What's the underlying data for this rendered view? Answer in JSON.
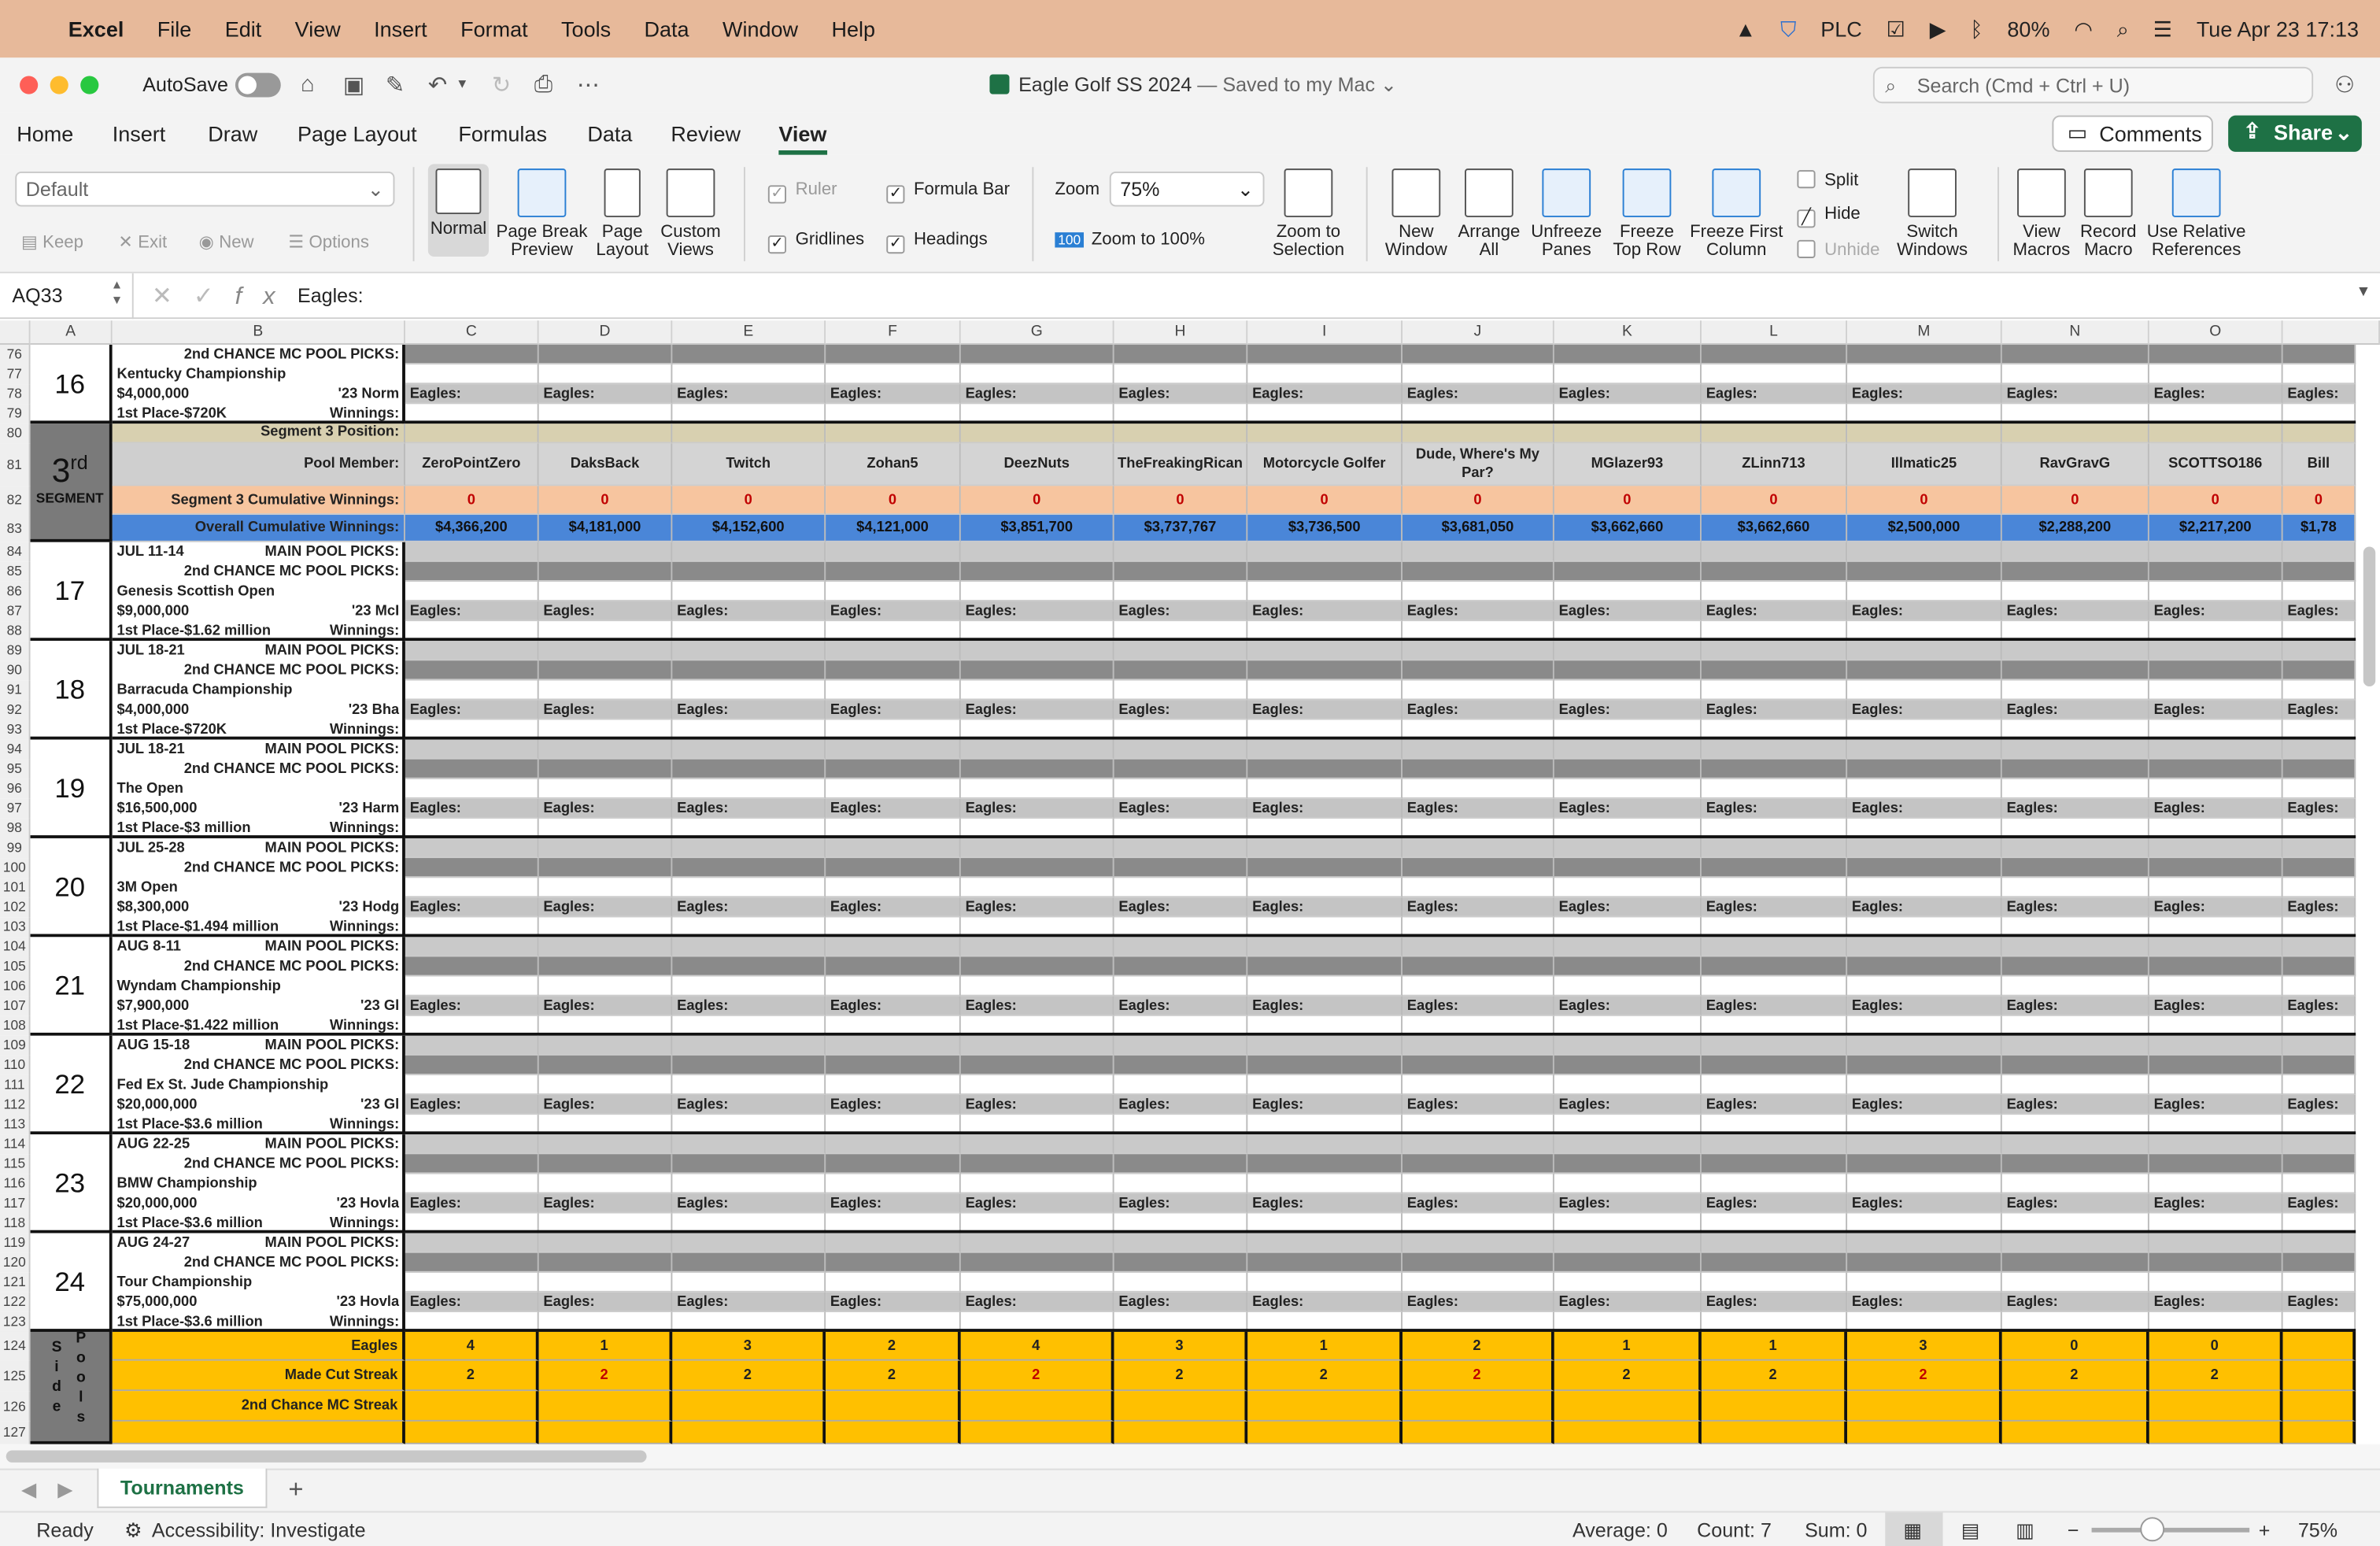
{
  "menubar": {
    "app": "Excel",
    "items": [
      "File",
      "Edit",
      "View",
      "Insert",
      "Format",
      "Tools",
      "Data",
      "Window",
      "Help"
    ],
    "plc": "PLC",
    "battery": "80%",
    "datetime": "Tue Apr 23  17:13"
  },
  "titlebar": {
    "autosave": "AutoSave",
    "doc_title": "Eagle Golf SS 2024",
    "saved": "— Saved to my Mac",
    "search_placeholder": "Search (Cmd + Ctrl + U)"
  },
  "tabs": [
    "Home",
    "Insert",
    "Draw",
    "Page Layout",
    "Formulas",
    "Data",
    "Review",
    "View"
  ],
  "active_tab": "View",
  "buttons": {
    "comments": "Comments",
    "share": "Share"
  },
  "ribbon": {
    "sheet_view": "Default",
    "keep": "Keep",
    "exit": "Exit",
    "new": "New",
    "options": "Options",
    "normal": "Normal",
    "page_break": "Page Break",
    "page_break2": "Preview",
    "page_layout": "Page",
    "page_layout2": "Layout",
    "custom": "Custom",
    "custom2": "Views",
    "ruler": "Ruler",
    "formula_bar": "Formula Bar",
    "gridlines": "Gridlines",
    "headings": "Headings",
    "zoom": "Zoom",
    "zoom_value": "75%",
    "zoom100_icon": "100",
    "zoom100": "Zoom to 100%",
    "zoom_sel": "Zoom to",
    "zoom_sel2": "Selection",
    "new_window": "New",
    "new_window2": "Window",
    "arrange": "Arrange",
    "arrange2": "All",
    "unfreeze": "Unfreeze",
    "unfreeze2": "Panes",
    "freeze_top": "Freeze",
    "freeze_top2": "Top Row",
    "freeze_first": "Freeze First",
    "freeze_first2": "Column",
    "split": "Split",
    "hide": "Hide",
    "unhide": "Unhide",
    "switch": "Switch",
    "switch2": "Windows",
    "view_macros": "View",
    "view_macros2": "Macros",
    "record": "Record",
    "record2": "Macro",
    "relative": "Use Relative",
    "relative2": "References"
  },
  "formula_bar": {
    "cell_ref": "AQ33",
    "fx": "fx",
    "value": "Eagles:"
  },
  "columns": [
    "A",
    "B",
    "C",
    "D",
    "E",
    "F",
    "G",
    "H",
    "I",
    "J",
    "K",
    "L",
    "M",
    "N",
    "O"
  ],
  "players": [
    "ZeroPointZero",
    "DaksBack",
    "Twitch",
    "Zohan5",
    "DeezNuts",
    "TheFreakingRican",
    "Motorcycle Golfer",
    "Dude, Where's My Par?",
    "MGlazer93",
    "ZLinn713",
    "Illmatic25",
    "RavGravG",
    "SCOTTSO186",
    "Bill"
  ],
  "segment": {
    "big": "3",
    "sup": "rd",
    "label": "SEGMENT",
    "position_label": "Segment 3 Position:",
    "pool_member": "Pool Member:",
    "seg_cum": "Segment 3 Cumulative Winnings:",
    "overall": "Overall Cumulative  Winnings:"
  },
  "seg_values": [
    "0",
    "0",
    "0",
    "0",
    "0",
    "0",
    "0",
    "0",
    "0",
    "0",
    "0",
    "0",
    "0",
    "0"
  ],
  "overall_values": [
    "$4,366,200",
    "$4,181,000",
    "$4,152,600",
    "$4,121,000",
    "$3,851,700",
    "$3,737,767",
    "$3,736,500",
    "$3,681,050",
    "$3,662,660",
    "$3,662,660",
    "$2,500,000",
    "$2,288,200",
    "$2,217,200",
    "$1,78"
  ],
  "eagles_label": "Eagles:",
  "labels": {
    "main": "MAIN POOL PICKS:",
    "chance": "2nd CHANCE MC POOL PICKS:",
    "winnings": "Winnings:"
  },
  "events": [
    {
      "num": "16",
      "rows": [
        "76",
        "77",
        "78",
        "79"
      ],
      "date": "",
      "name": "Kentucky Championship",
      "purse": "$4,000,000",
      "prev": "'23  Norm",
      "first": "1st Place-$720K"
    },
    {
      "num": "17",
      "rows": [
        "84",
        "85",
        "86",
        "87",
        "88"
      ],
      "date": "JUL 11-14",
      "name": "Genesis Scottish Open",
      "purse": "$9,000,000",
      "prev": "'23 McI",
      "first": "1st Place-$1.62 million"
    },
    {
      "num": "18",
      "rows": [
        "89",
        "90",
        "91",
        "92",
        "93"
      ],
      "date": "JUL 18-21",
      "name": "Barracuda Championship",
      "purse": "$4,000,000",
      "prev": "'23 Bha",
      "first": "1st Place-$720K"
    },
    {
      "num": "19",
      "rows": [
        "94",
        "95",
        "96",
        "97",
        "98"
      ],
      "date": "JUL 18-21",
      "name": "The Open",
      "purse": "$16,500,000",
      "prev": "'23  Harm",
      "first": "1st  Place-$3 million"
    },
    {
      "num": "20",
      "rows": [
        "99",
        "100",
        "101",
        "102",
        "103"
      ],
      "date": "JUL 25-28",
      "name": "3M Open",
      "purse": "$8,300,000",
      "prev": "'23  Hodg",
      "first": "1st Place-$1.494 million"
    },
    {
      "num": "21",
      "rows": [
        "104",
        "105",
        "106",
        "107",
        "108"
      ],
      "date": "AUG 8-11",
      "name": "Wyndam Championship",
      "purse": "$7,900,000",
      "prev": "'23  Gl",
      "first": "1st Place-$1.422 million"
    },
    {
      "num": "22",
      "rows": [
        "109",
        "110",
        "111",
        "112",
        "113"
      ],
      "date": "AUG 15-18",
      "name": "Fed Ex St. Jude Championship",
      "purse": "$20,000,000",
      "prev": "'23  Gl",
      "first": "1st Place-$3.6 million"
    },
    {
      "num": "23",
      "rows": [
        "114",
        "115",
        "116",
        "117",
        "118"
      ],
      "date": "AUG 22-25",
      "name": "BMW Championship",
      "purse": "$20,000,000",
      "prev": "'23 Hovla",
      "first": "1st Place-$3.6 million"
    },
    {
      "num": "24",
      "rows": [
        "119",
        "120",
        "121",
        "122",
        "123"
      ],
      "date": "AUG 24-27",
      "name": "Tour Championship",
      "purse": "$75,000,000",
      "prev": "'23 Hovla",
      "first": "1st Place-$3.6 million"
    }
  ],
  "side_pools": {
    "letters1": [
      "S",
      "i",
      "d",
      "e"
    ],
    "letters2": [
      "P",
      "o",
      "o",
      "l",
      "s"
    ],
    "eagles": "Eagles",
    "made_cut": "Made Cut Streak",
    "chance": "2nd Chance MC Streak",
    "eagles_vals": [
      "4",
      "1",
      "3",
      "2",
      "4",
      "3",
      "1",
      "2",
      "1",
      "1",
      "3",
      "0",
      "0",
      ""
    ],
    "made_cut_vals": [
      "2",
      "2",
      "2",
      "2",
      "2",
      "2",
      "2",
      "2",
      "2",
      "2",
      "2",
      "2",
      "2",
      ""
    ],
    "rows": [
      "124",
      "125",
      "126",
      "127"
    ]
  },
  "sheet_tab": "Tournaments",
  "status": {
    "ready": "Ready",
    "accessibility": "Accessibility: Investigate",
    "average": "Average: 0",
    "count": "Count: 7",
    "sum": "Sum: 0",
    "zoom": "75%"
  },
  "colors": {
    "accent": "#1e7145",
    "orange": "#f7c59f",
    "blue": "#4a86d8",
    "yellow": "#ffc000",
    "tan": "#d8d0b0"
  }
}
